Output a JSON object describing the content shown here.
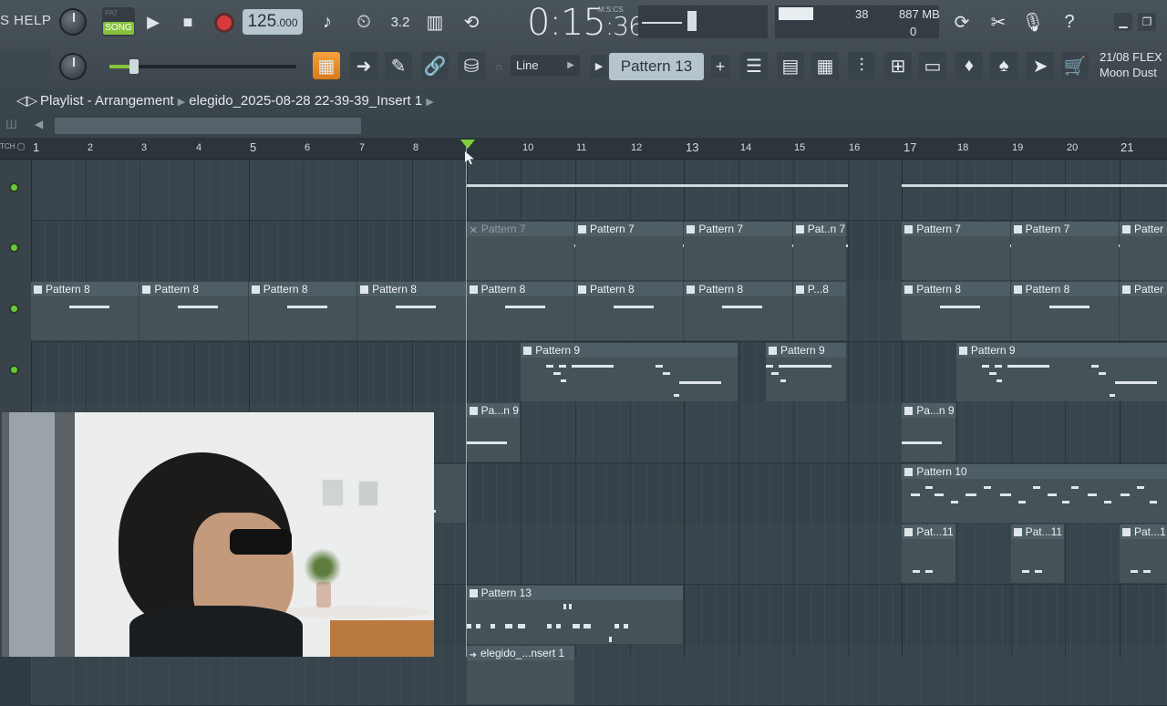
{
  "menu": {
    "help_label": "S HELP"
  },
  "transport": {
    "pat_label": "PAT",
    "song_label": "SONG",
    "tempo_main": "125",
    "tempo_dec": ".000",
    "time_main": "0:15",
    "time_sec": ":36",
    "time_format": "M:S:CS"
  },
  "monitor": {
    "cpu": "38",
    "ram": "887 MB",
    "voices": "0"
  },
  "toolbar2": {
    "snap_value": "Line",
    "pattern_selector": "Pattern 13",
    "plugin_date": "21/08",
    "plugin_name_1": "FLEX",
    "plugin_name_2": "Moon Dust"
  },
  "playlist": {
    "window_title": "Playlist - Arrangement",
    "project_name": "elegido_2025-08-28 22-39-39_Insert 1"
  },
  "timeline": {
    "bars": [
      "1",
      "2",
      "3",
      "4",
      "5",
      "6",
      "7",
      "8",
      "10",
      "11",
      "12",
      "13",
      "14",
      "15",
      "16",
      "17",
      "18",
      "19",
      "20",
      "21"
    ]
  },
  "clips": {
    "pattern7": "Pattern 7",
    "pattern7_short": "Pat..n 7",
    "pattern8": "Pattern 8",
    "pattern8_short": "P...8",
    "pattern9": "Pattern 9",
    "pattern9_short": "Pa...n 9",
    "pattern10": "Pattern 10",
    "pattern11": "Pat...11",
    "pattern_cut": "Patter",
    "pattern11_cut": "Pat...1",
    "pattern13": "Pattern 13",
    "audio_clip": "elegido_...nsert 1"
  },
  "colors": {
    "accent_green": "#7fd13b",
    "record_red": "#d63a3a",
    "song_green": "#86c23a",
    "background": "#2f3b42"
  }
}
